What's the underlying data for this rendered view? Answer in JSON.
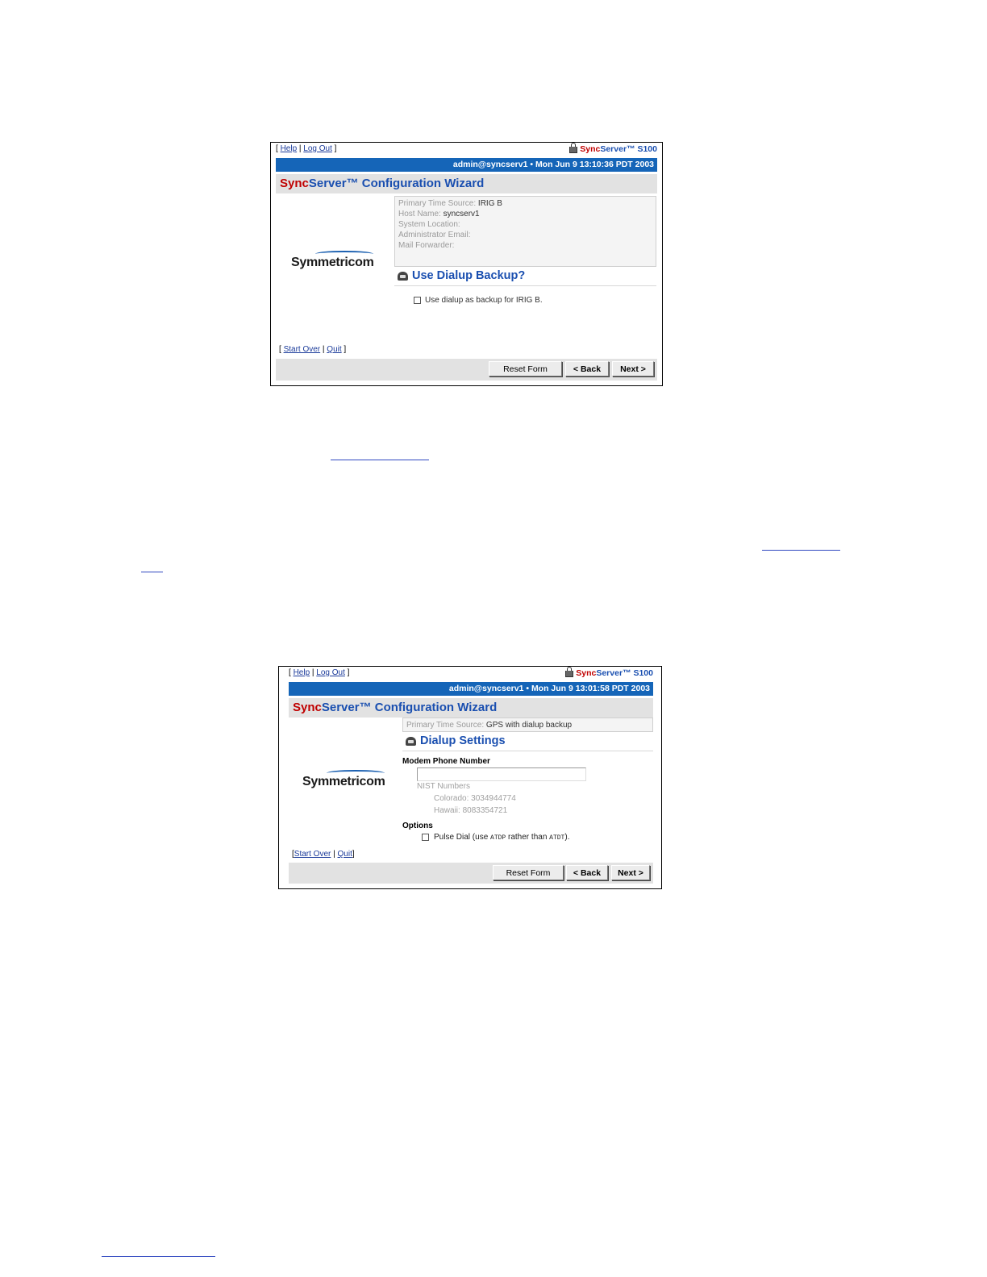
{
  "screen1": {
    "help": "Help",
    "logout": "Log Out",
    "brand_sync": "Sync",
    "brand_server": "Server™",
    "brand_model": "S100",
    "status": "admin@syncserv1  •  Mon Jun 9 13:10:36 PDT 2003",
    "title_sync": "Sync",
    "title_rest": "Server™ Configuration Wizard",
    "logo": "Symmetricom",
    "summary": [
      {
        "label": "Primary Time Source: ",
        "value": "IRIG B"
      },
      {
        "label": "Host Name: ",
        "value": "syncserv1"
      },
      {
        "label": "System Location:",
        "value": ""
      },
      {
        "label": "Administrator Email:",
        "value": ""
      },
      {
        "label": "Mail Forwarder:",
        "value": ""
      }
    ],
    "section_title": "Use Dialup Backup?",
    "checkbox_label": "Use dialup as backup for IRIG B.",
    "start_over": "Start Over",
    "quit": "Quit",
    "reset": "Reset Form",
    "back": "< Back",
    "next": "Next >"
  },
  "screen2": {
    "help": "Help",
    "logout": "Log Out",
    "brand_sync": "Sync",
    "brand_server": "Server™",
    "brand_model": "S100",
    "status": "admin@syncserv1  •  Mon Jun 9 13:01:58 PDT 2003",
    "title_sync": "Sync",
    "title_rest": "Server™ Configuration Wizard",
    "logo": "Symmetricom",
    "summary_label": "Primary Time Source: ",
    "summary_value": "GPS with dialup backup",
    "section_title": "Dialup Settings",
    "modem_label": "Modem Phone Number",
    "modem_value": "",
    "nist_title": "NIST Numbers",
    "nist_colorado": "Colorado: 3034944774",
    "nist_hawaii": "Hawaii: 8083354721",
    "options_label": "Options",
    "pulse_pre": "Pulse Dial (use ",
    "pulse_code1": "ATDP",
    "pulse_mid": " rather than ",
    "pulse_code2": "ATDT",
    "pulse_post": ").",
    "start_over": "Start Over",
    "quit": "Quit",
    "reset": "Reset Form",
    "back": "< Back",
    "next": "Next >"
  }
}
